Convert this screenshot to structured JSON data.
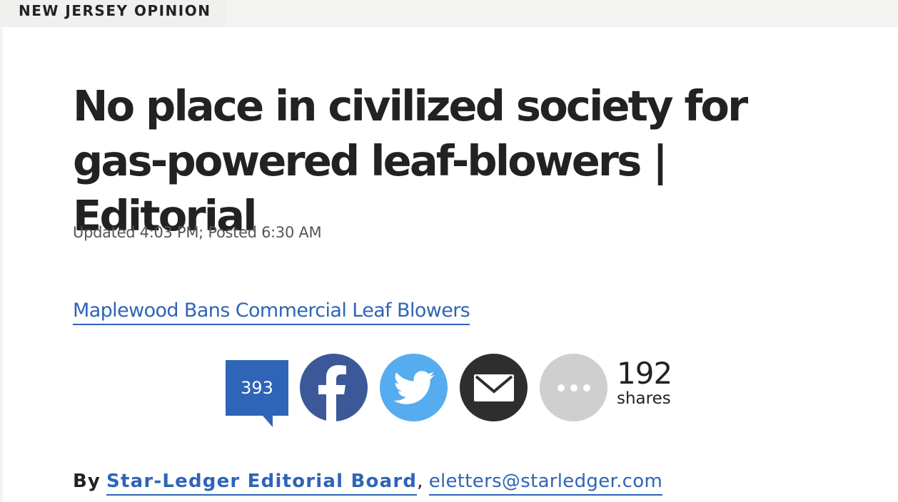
{
  "section": {
    "label": "NEW JERSEY OPINION"
  },
  "article": {
    "headline": "No place in civilized society for gas-powered leaf-blowers | Editorial",
    "timestamp": "Updated 4:03 PM; Posted 6:30 AM",
    "related_link": "Maplewood Bans Commercial Leaf Blowers"
  },
  "share": {
    "comments_count": "393",
    "buttons": [
      {
        "name": "facebook",
        "icon": "facebook-icon",
        "color": "#3b5998"
      },
      {
        "name": "twitter",
        "icon": "twitter-icon",
        "color": "#55acee"
      },
      {
        "name": "email",
        "icon": "mail-icon",
        "color": "#2e2e2e"
      },
      {
        "name": "more",
        "icon": "more-icon",
        "color": "#cfcfcf"
      }
    ],
    "shares_count": "192",
    "shares_label": "shares"
  },
  "byline": {
    "prefix": "By",
    "author": "Star-Ledger Editorial Board",
    "separator": ",",
    "email": "eletters@starledger.com"
  },
  "colors": {
    "link": "#2f64b7",
    "text": "#222222",
    "meta": "#555555"
  }
}
